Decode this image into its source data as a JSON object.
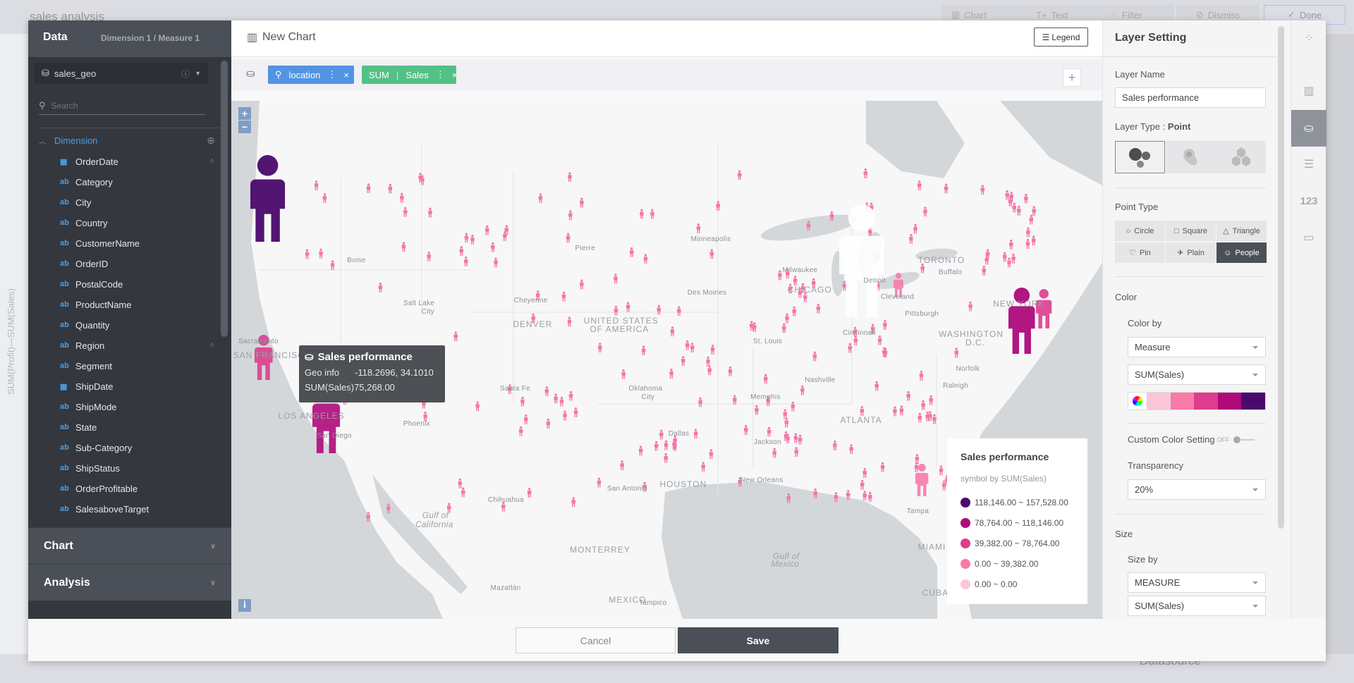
{
  "background": {
    "title": "sales analysis",
    "toolbar": [
      "Chart",
      "Text",
      "Filter",
      "Dismiss",
      "Done"
    ],
    "vertical_axis": "SUM(Profit)—SUM(Sales)",
    "datasource": "Datasource"
  },
  "left": {
    "title": "Data",
    "counts": "Dimension 1 / Measure 1",
    "dataset": "sales_geo",
    "search_placeholder": "Search",
    "dimension_label": "Dimension",
    "fields": [
      {
        "name": "OrderDate",
        "type": "date",
        "filter": true
      },
      {
        "name": "Category",
        "type": "ab"
      },
      {
        "name": "City",
        "type": "ab"
      },
      {
        "name": "Country",
        "type": "ab"
      },
      {
        "name": "CustomerName",
        "type": "ab"
      },
      {
        "name": "OrderID",
        "type": "ab"
      },
      {
        "name": "PostalCode",
        "type": "ab"
      },
      {
        "name": "ProductName",
        "type": "ab"
      },
      {
        "name": "Quantity",
        "type": "ab"
      },
      {
        "name": "Region",
        "type": "ab",
        "filter": true
      },
      {
        "name": "Segment",
        "type": "ab"
      },
      {
        "name": "ShipDate",
        "type": "date"
      },
      {
        "name": "ShipMode",
        "type": "ab"
      },
      {
        "name": "State",
        "type": "ab"
      },
      {
        "name": "Sub-Category",
        "type": "ab"
      },
      {
        "name": "ShipStatus",
        "type": "ab"
      },
      {
        "name": "OrderProfitable",
        "type": "ab"
      },
      {
        "name": "SalesaboveTarget",
        "type": "ab"
      }
    ],
    "sections": [
      "Chart",
      "Analysis"
    ]
  },
  "center": {
    "title": "New Chart",
    "legend_button": "Legend",
    "shelf": {
      "location": "location",
      "agg": "SUM",
      "measure": "Sales",
      "remove": "×"
    }
  },
  "map": {
    "labels": [
      "Boise",
      "Pierre",
      "Minneapolis",
      "Milwaukee",
      "TORONTO",
      "Buffalo",
      "CHICAGO",
      "Des Moines",
      "Cleveland",
      "Pittsburgh",
      "Cheyenne",
      "Salt Lake",
      "City",
      "DENVER",
      "UNITED STATES",
      "OF AMERICA",
      "St. Louis",
      "Cincinnati",
      "WASHINGTON",
      "D.C.",
      "Norfolk",
      "Raleigh",
      "Nashville",
      "Santa Fe",
      "Oklahoma",
      "City",
      "Memphis",
      "ATLANTA",
      "Phoenix",
      "Dallas",
      "Jackson",
      "LOS ANGELES",
      "San Diego",
      "SAN FRANCISCO",
      "Sacramento",
      "San Antonio",
      "HOUSTON",
      "New Orleans",
      "Tampa",
      "MIAMI",
      "Chihuahua",
      "Gulf of",
      "California",
      "MONTERREY",
      "Gulf of",
      "Mexico",
      "Mazatlán",
      "MEXICO",
      "Tampico",
      "CUBA",
      "Detroit",
      "NEW YORK"
    ],
    "zoom_in": "+",
    "zoom_out": "−",
    "info": "i",
    "colors": {
      "land": "#f7f7f7",
      "water": "#d4d7da",
      "small_marker": "#f377a8"
    },
    "tooltip": {
      "title": "Sales performance",
      "geo_label": "Geo info",
      "geo_value": "-118.2696, 34.1010",
      "measure_label": "SUM(Sales)",
      "measure_value": "75,268.00"
    },
    "legend": {
      "title": "Sales performance",
      "subtitle": "symbol by SUM(Sales)",
      "items": [
        {
          "range": "118,146.00 ~ 157,528.00",
          "color": "#4a0a6b"
        },
        {
          "range": "78,764.00 ~ 118,146.00",
          "color": "#ae0a7b"
        },
        {
          "range": "39,382.00 ~ 78,764.00",
          "color": "#dd3d8e"
        },
        {
          "range": "0.00 ~ 39,382.00",
          "color": "#f87aa9"
        },
        {
          "range": "0.00 ~ 0.00",
          "color": "#fac6d9"
        }
      ]
    }
  },
  "right": {
    "title": "Layer Setting",
    "layer_name_label": "Layer Name",
    "layer_name": "Sales performance",
    "layer_type_label": "Layer Type : ",
    "layer_type": "Point",
    "point_type_label": "Point Type",
    "point_types": [
      "Circle",
      "Square",
      "Triangle",
      "Pin",
      "Plain",
      "People"
    ],
    "selected_point_type": "People",
    "color_label": "Color",
    "color_by_label": "Color by",
    "color_by": "Measure",
    "color_measure": "SUM(Sales)",
    "palette": [
      "#fac6d9",
      "#f87aa9",
      "#dd3d8e",
      "#ae0a7b",
      "#4a0a6b"
    ],
    "custom_color_label": "Custom Color Setting",
    "custom_color_state": "OFF",
    "transparency_label": "Transparency",
    "transparency": "20%",
    "size_label": "Size",
    "size_by_label": "Size by",
    "size_by": "MEASURE",
    "size_measure": "SUM(Sales)",
    "iconbar_number": "123"
  },
  "footer": {
    "cancel": "Cancel",
    "save": "Save"
  }
}
